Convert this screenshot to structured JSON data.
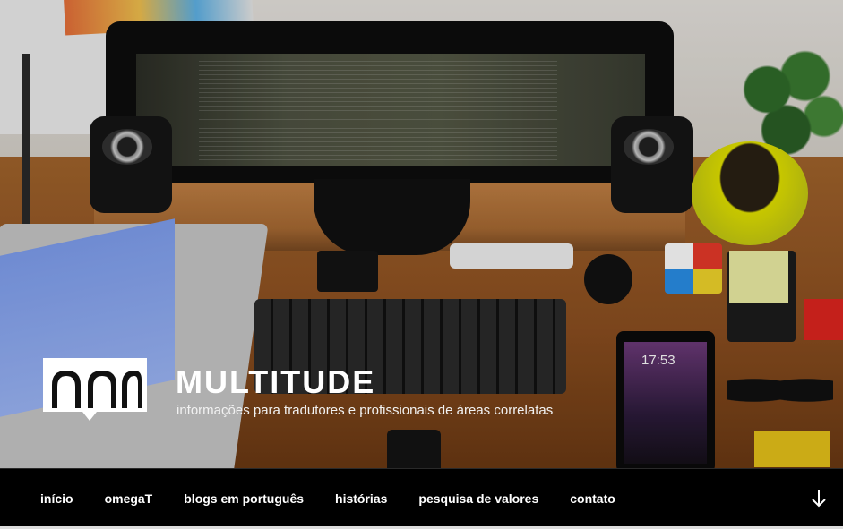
{
  "site": {
    "title": "MULTITUDE",
    "description": "informações para tradutores e profissionais de áreas correlatas"
  },
  "hero": {
    "tablet_time": "17:53"
  },
  "nav": {
    "items": [
      {
        "label": "início"
      },
      {
        "label": "omegaT"
      },
      {
        "label": "blogs em português"
      },
      {
        "label": "histórias"
      },
      {
        "label": "pesquisa de valores"
      },
      {
        "label": "contato"
      }
    ],
    "scroll_icon": "arrow-down-icon"
  },
  "colors": {
    "nav_background": "#000000",
    "text": "#ffffff"
  }
}
